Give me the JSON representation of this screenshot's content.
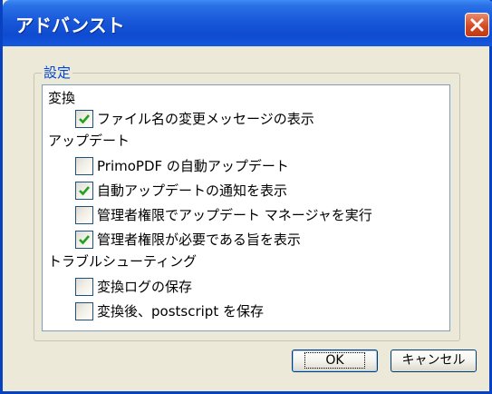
{
  "window": {
    "title": "アドバンスト"
  },
  "group": {
    "label": "設定"
  },
  "list": [
    {
      "type": "header",
      "label": "変換"
    },
    {
      "type": "option",
      "label": "ファイル名の変更メッセージの表示",
      "checked": true
    },
    {
      "type": "header",
      "label": "アップデート"
    },
    {
      "type": "option",
      "label": "PrimoPDF の自動アップデート",
      "checked": false
    },
    {
      "type": "option",
      "label": "自動アップデートの通知を表示",
      "checked": true
    },
    {
      "type": "option",
      "label": "管理者権限でアップデート マネージャを実行",
      "checked": false
    },
    {
      "type": "option",
      "label": "管理者権限が必要である旨を表示",
      "checked": true
    },
    {
      "type": "header",
      "label": "トラブルシューティング"
    },
    {
      "type": "option",
      "label": "変換ログの保存",
      "checked": false
    },
    {
      "type": "option",
      "label": "変換後、postscript を保存",
      "checked": false
    }
  ],
  "buttons": {
    "ok": "OK",
    "cancel": "キャンセル"
  },
  "colors": {
    "title_bar": "#0e4bd0",
    "check_mark": "#21a121",
    "group_label": "#0046d5"
  }
}
